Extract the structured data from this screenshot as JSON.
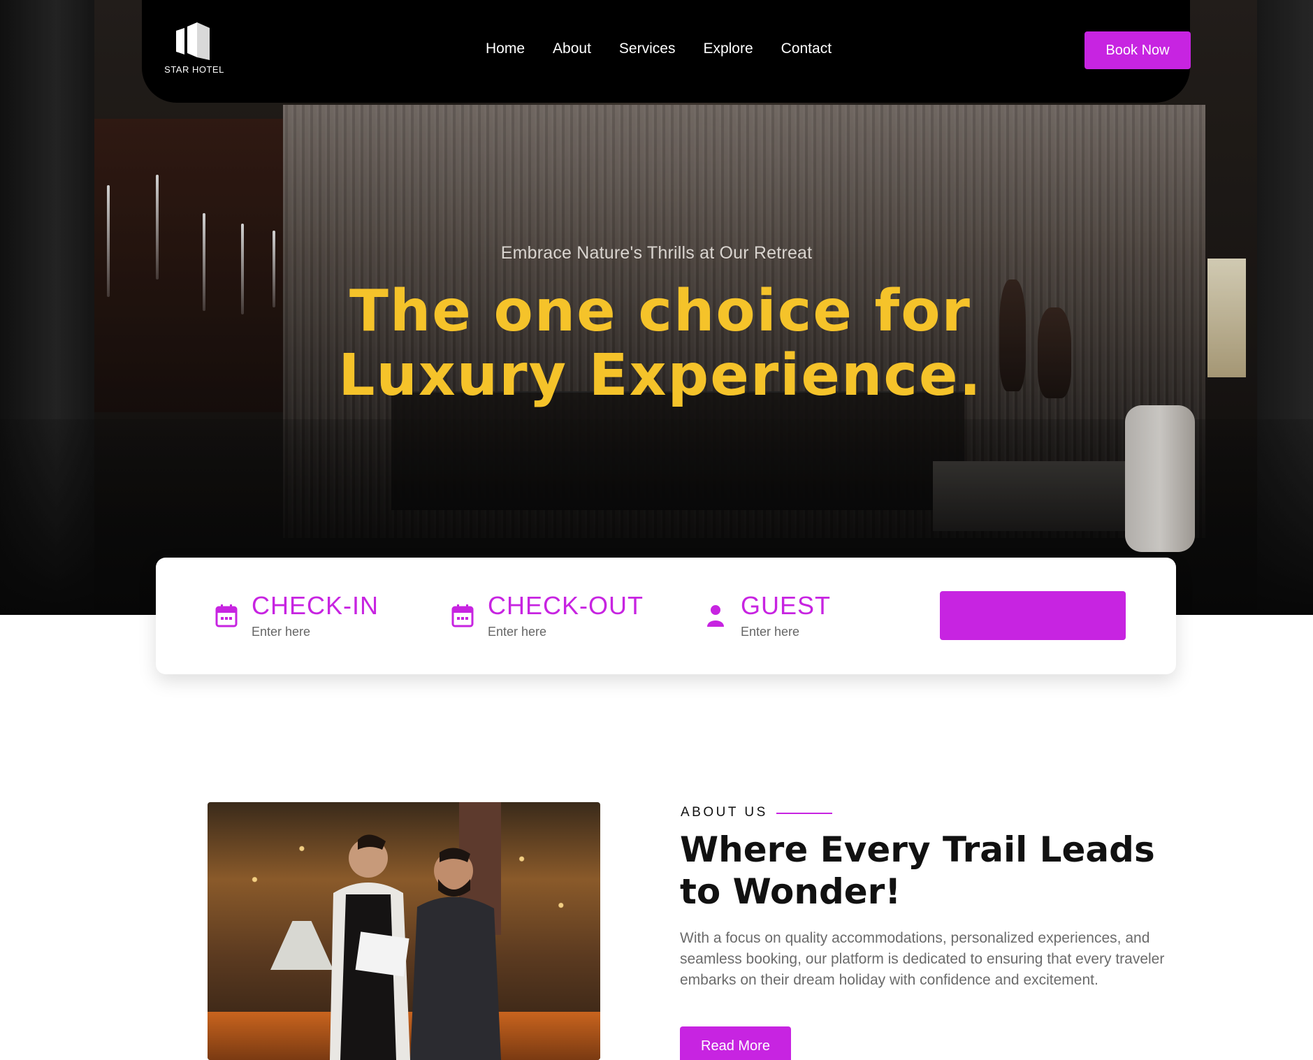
{
  "brand": {
    "name": "STAR HOTEL",
    "logo_icon": "building-logo"
  },
  "nav": {
    "items": [
      {
        "label": "Home"
      },
      {
        "label": "About"
      },
      {
        "label": "Services"
      },
      {
        "label": "Explore"
      },
      {
        "label": "Contact"
      }
    ],
    "cta_label": "Book Now"
  },
  "hero": {
    "tagline": "Embrace Nature's Thrills at Our Retreat",
    "headline_line1": "The one choice for",
    "headline_line2": "Luxury Experience."
  },
  "booking": {
    "fields": [
      {
        "label": "CHECK-IN",
        "placeholder": "Enter here",
        "icon": "calendar-icon"
      },
      {
        "label": "CHECK-OUT",
        "placeholder": "Enter here",
        "icon": "calendar-icon"
      },
      {
        "label": "GUEST",
        "placeholder": "Enter here",
        "icon": "user-icon"
      }
    ],
    "search_label": ""
  },
  "about": {
    "kicker": "ABOUT US",
    "title": "Where Every Trail Leads to Wonder!",
    "text": "With a focus on quality accommodations, personalized experiences, and seamless booking, our platform is dedicated to ensuring that every traveler embarks on their dream holiday with confidence and excitement.",
    "button_label": "Read More"
  },
  "colors": {
    "accent": "#c724e1",
    "headline": "#f5c32a",
    "nav_bg": "#000000"
  }
}
